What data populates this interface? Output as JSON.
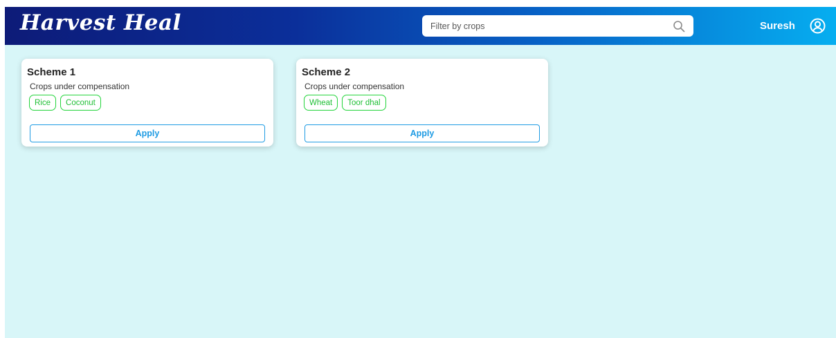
{
  "app": {
    "logo": "Harvest Heal"
  },
  "search": {
    "placeholder": "Filter by crops",
    "value": ""
  },
  "user": {
    "name": "Suresh"
  },
  "schemes": [
    {
      "title": "Scheme 1",
      "subtitle": "Crops under compensation",
      "crops": [
        "Rice",
        "Coconut"
      ],
      "action_label": "Apply"
    },
    {
      "title": "Scheme 2",
      "subtitle": "Crops under compensation",
      "crops": [
        "Wheat",
        "Toor dhal"
      ],
      "action_label": "Apply"
    }
  ],
  "colors": {
    "header_gradient_start": "#0d1b78",
    "header_gradient_end": "#06aef0",
    "page_background": "#d8f6f8",
    "chip_green": "#22d43a",
    "apply_blue": "#1e9be3"
  },
  "icons": {
    "search": "search-icon",
    "user": "user-profile-icon"
  }
}
